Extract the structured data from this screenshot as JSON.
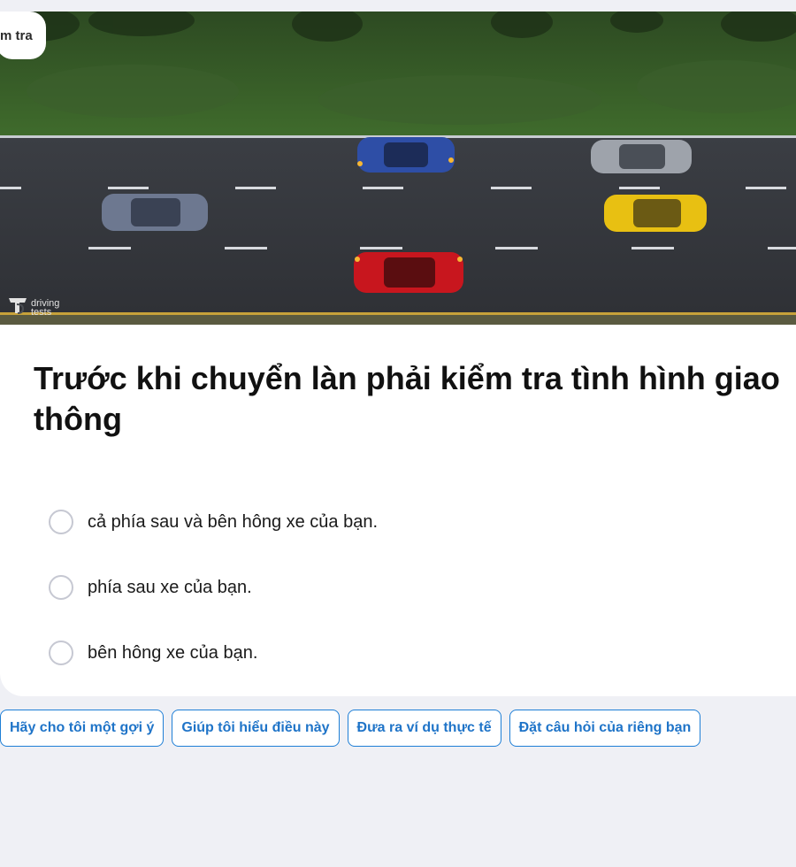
{
  "question": {
    "partial_tab_label": "m tra",
    "image_watermark": "driving tests",
    "title": "Trước khi chuyển làn phải kiểm tra tình hình giao thông",
    "options": [
      {
        "label": "cả phía sau và bên hông xe của bạn."
      },
      {
        "label": "phía sau xe của bạn."
      },
      {
        "label": "bên hông xe của bạn."
      }
    ]
  },
  "suggestions": [
    {
      "label": "Hãy cho tôi một gợi ý"
    },
    {
      "label": "Giúp tôi hiểu điều này"
    },
    {
      "label": "Đưa ra ví dụ thực tế"
    },
    {
      "label": "Đặt câu hỏi của riêng bạn"
    }
  ],
  "colors": {
    "page_bg": "#eff0f5",
    "card_bg": "#ffffff",
    "accent": "#1f74c8",
    "radio_border": "#c6c8d2"
  }
}
